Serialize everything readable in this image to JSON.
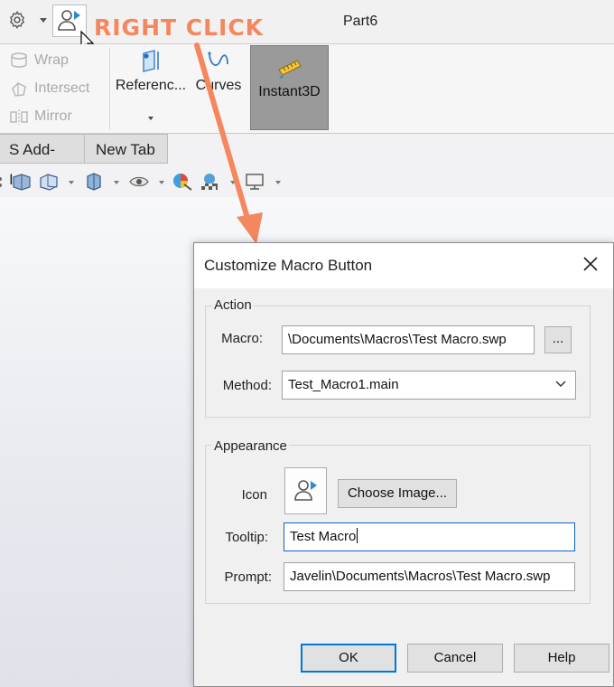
{
  "titlebar": {
    "annotation": "RIGHT CLICK",
    "document_title": "Part6"
  },
  "ribbon": {
    "features": [
      "Wrap",
      "Intersect",
      "Mirror"
    ],
    "reference_label": "Referenc...",
    "curves_label": "Curves",
    "instant3d_label": "Instant3D"
  },
  "tabs": [
    "S Add-Ins",
    "New Tab"
  ],
  "dialog": {
    "title": "Customize Macro Button",
    "action_group": "Action",
    "macro_label": "Macro:",
    "macro_value": "\\Documents\\Macros\\Test Macro.swp",
    "browse_label": "...",
    "method_label": "Method:",
    "method_value": "Test_Macro1.main",
    "appearance_group": "Appearance",
    "icon_label": "Icon",
    "choose_image_label": "Choose Image...",
    "tooltip_label": "Tooltip:",
    "tooltip_value": "Test Macro",
    "prompt_label": "Prompt:",
    "prompt_value": "Javelin\\Documents\\Macros\\Test Macro.swp",
    "ok_label": "OK",
    "cancel_label": "Cancel",
    "help_label": "Help"
  },
  "colors": {
    "annotation": "#f4875e",
    "focus": "#0a64c8",
    "default_button": "#0078d7"
  }
}
